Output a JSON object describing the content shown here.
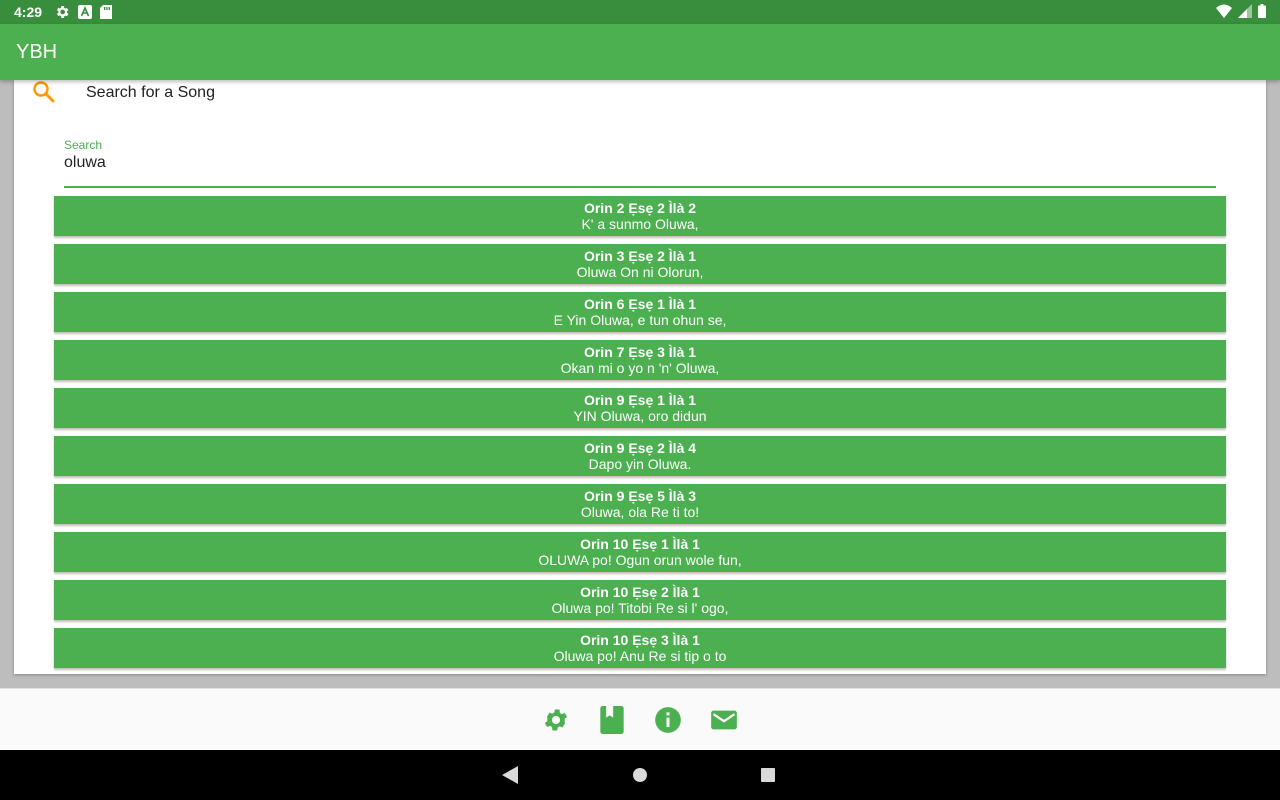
{
  "status": {
    "time": "4:29",
    "icons": [
      "settings-icon",
      "a-icon",
      "sd-card-icon",
      "wifi-icon",
      "signal-icon",
      "battery-icon"
    ]
  },
  "app": {
    "title": "YBH"
  },
  "search": {
    "header_label": "Search for a Song",
    "field_label": "Search",
    "value": "oluwa"
  },
  "results": [
    {
      "ref": "Orin 2 Ẹsẹ 2 Ìlà 2",
      "line": "K' a sunmo Oluwa,"
    },
    {
      "ref": "Orin 3 Ẹsẹ 2 Ìlà 1",
      "line": "Oluwa On ni Olorun,"
    },
    {
      "ref": "Orin 6 Ẹsẹ 1 Ìlà 1",
      "line": "E Yin Oluwa, e tun ohun se,"
    },
    {
      "ref": "Orin 7 Ẹsẹ 3 Ìlà 1",
      "line": "Okan mi o yo n 'n' Oluwa,"
    },
    {
      "ref": "Orin 9 Ẹsẹ 1 Ìlà 1",
      "line": "YIN Oluwa, oro didun"
    },
    {
      "ref": "Orin 9 Ẹsẹ 2 Ìlà 4",
      "line": "Dapo yin Oluwa."
    },
    {
      "ref": "Orin 9 Ẹsẹ 5 Ìlà 3",
      "line": "Oluwa, ola Re ti to!"
    },
    {
      "ref": "Orin 10 Ẹsẹ 1 Ìlà 1",
      "line": "OLUWA po! Ogun orun wole fun,"
    },
    {
      "ref": "Orin 10 Ẹsẹ 2 Ìlà 1",
      "line": "Oluwa po! Titobi Re si l' ogo,"
    },
    {
      "ref": "Orin 10 Ẹsẹ 3 Ìlà 1",
      "line": "Oluwa po! Anu Re si tip o to"
    }
  ],
  "bottom_actions": [
    "settings-icon",
    "book-icon",
    "info-icon",
    "mail-icon"
  ],
  "colors": {
    "primary": "#4caf50",
    "primary_dark": "#388e3c",
    "accent": "#ff9800"
  }
}
